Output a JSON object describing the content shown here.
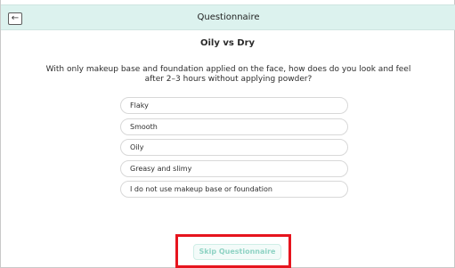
{
  "header": {
    "title": "Questionnaire",
    "back_icon": "←"
  },
  "page": {
    "subtitle": "Oily vs Dry",
    "question": "With only makeup base and foundation applied on the face, how does do you look and feel after 2–3 hours without applying powder?"
  },
  "options": [
    {
      "label": "Flaky"
    },
    {
      "label": "Smooth"
    },
    {
      "label": "Oily"
    },
    {
      "label": "Greasy and slimy"
    },
    {
      "label": "I do not use makeup base or foundation"
    }
  ],
  "footer": {
    "skip_label": "Skip Questionnaire"
  },
  "colors": {
    "header_bg": "#dcf2ee",
    "skip_text": "#8fd3c4",
    "highlight_border": "#e6141e"
  }
}
